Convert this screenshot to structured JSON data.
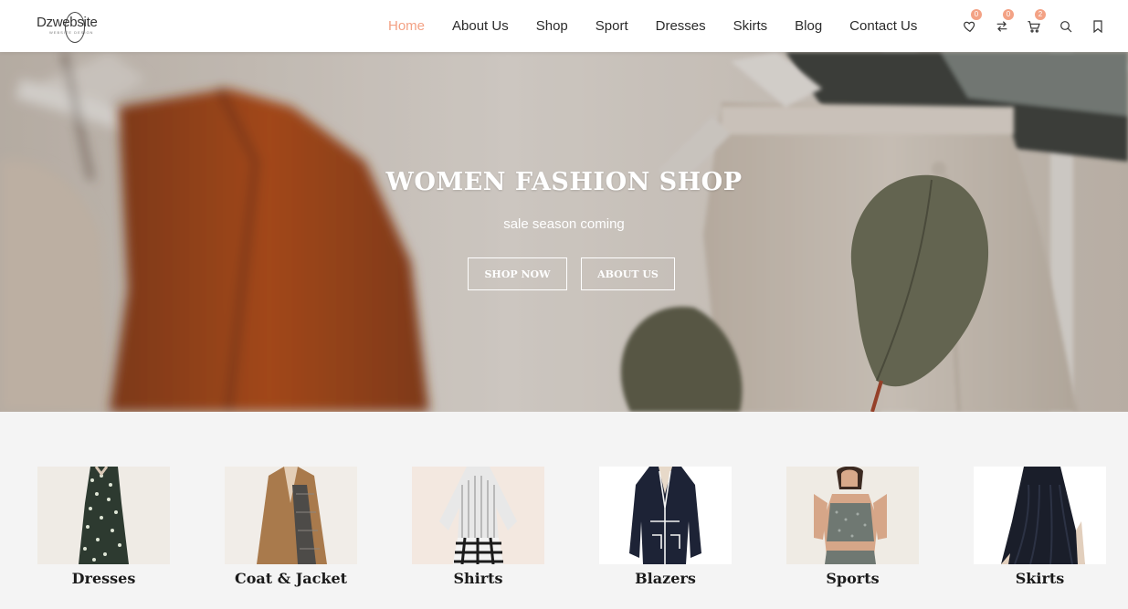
{
  "header": {
    "logo_text": "Dzwebsite",
    "logo_tagline": "WEBSITE DESIGN",
    "nav": [
      {
        "label": "Home",
        "active": true
      },
      {
        "label": "About Us",
        "active": false
      },
      {
        "label": "Shop",
        "active": false
      },
      {
        "label": "Sport",
        "active": false
      },
      {
        "label": "Dresses",
        "active": false
      },
      {
        "label": "Skirts",
        "active": false
      },
      {
        "label": "Blog",
        "active": false
      },
      {
        "label": "Contact Us",
        "active": false
      }
    ],
    "icons": {
      "wishlist": {
        "icon": "heart-icon",
        "count": "0"
      },
      "compare": {
        "icon": "compare-arrows-icon",
        "count": "0"
      },
      "cart": {
        "icon": "cart-icon",
        "count": "2"
      },
      "search": {
        "icon": "search-icon"
      },
      "bookmark": {
        "icon": "bookmark-icon"
      }
    },
    "accent_color": "#f3a285"
  },
  "hero": {
    "title": "WOMEN FASHION SHOP",
    "subtitle": "sale season coming",
    "primary_button": "SHOP NOW",
    "secondary_button": "ABOUT US"
  },
  "categories": [
    {
      "label": "Dresses"
    },
    {
      "label": "Coat & Jacket"
    },
    {
      "label": "Shirts"
    },
    {
      "label": "Blazers"
    },
    {
      "label": "Sports"
    },
    {
      "label": "Skirts"
    }
  ]
}
